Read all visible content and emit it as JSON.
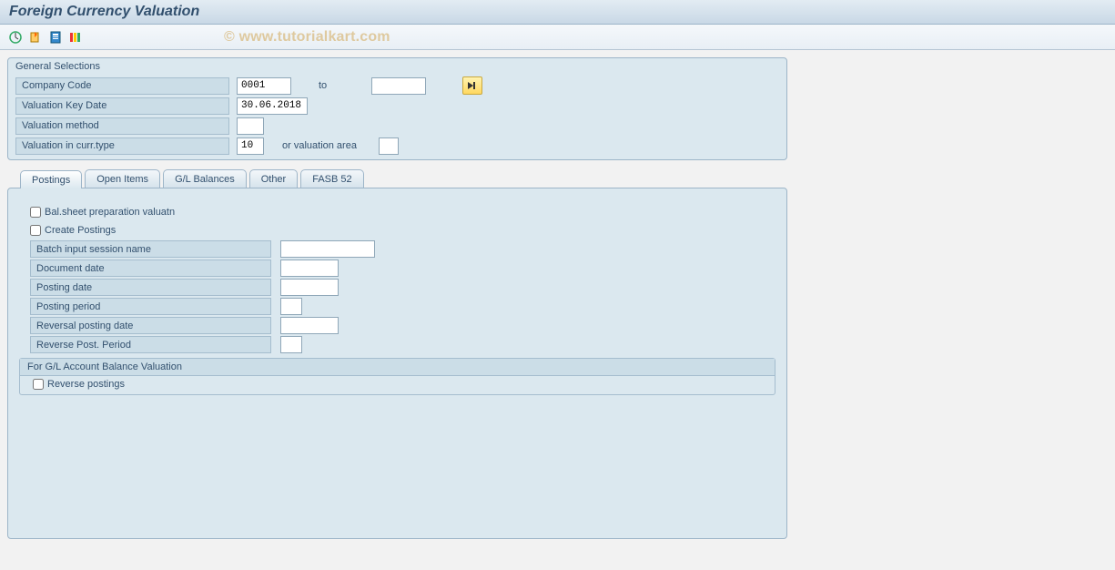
{
  "title": "Foreign Currency Valuation",
  "watermark": "© www.tutorialkart.com",
  "general_selections": {
    "heading": "General Selections",
    "company_code": {
      "label": "Company Code",
      "value": "0001",
      "to_label": "to",
      "to_value": ""
    },
    "valuation_key_date": {
      "label": "Valuation Key Date",
      "value": "30.06.2018"
    },
    "valuation_method": {
      "label": "Valuation method",
      "value": ""
    },
    "valuation_curr_type": {
      "label": "Valuation in curr.type",
      "value": "10",
      "or_label": "or valuation area",
      "area_value": ""
    }
  },
  "tabs": [
    {
      "id": "postings",
      "label": "Postings",
      "active": true
    },
    {
      "id": "open_items",
      "label": "Open Items",
      "active": false
    },
    {
      "id": "gl_balances",
      "label": "G/L Balances",
      "active": false
    },
    {
      "id": "other",
      "label": "Other",
      "active": false
    },
    {
      "id": "fasb52",
      "label": "FASB 52",
      "active": false
    }
  ],
  "postings_tab": {
    "bal_sheet": {
      "label": "Bal.sheet preparation valuatn",
      "checked": false
    },
    "create_postings": {
      "label": "Create Postings",
      "checked": false
    },
    "batch_input": {
      "label": "Batch input session name",
      "value": ""
    },
    "doc_date": {
      "label": "Document date",
      "value": ""
    },
    "posting_date": {
      "label": "Posting date",
      "value": ""
    },
    "posting_period": {
      "label": "Posting period",
      "value": ""
    },
    "reversal_date": {
      "label": "Reversal posting date",
      "value": ""
    },
    "reverse_period": {
      "label": "Reverse Post. Period",
      "value": ""
    },
    "sub_group": {
      "title": "For G/L Account Balance Valuation",
      "reverse_postings": {
        "label": "Reverse postings",
        "checked": false
      }
    }
  }
}
